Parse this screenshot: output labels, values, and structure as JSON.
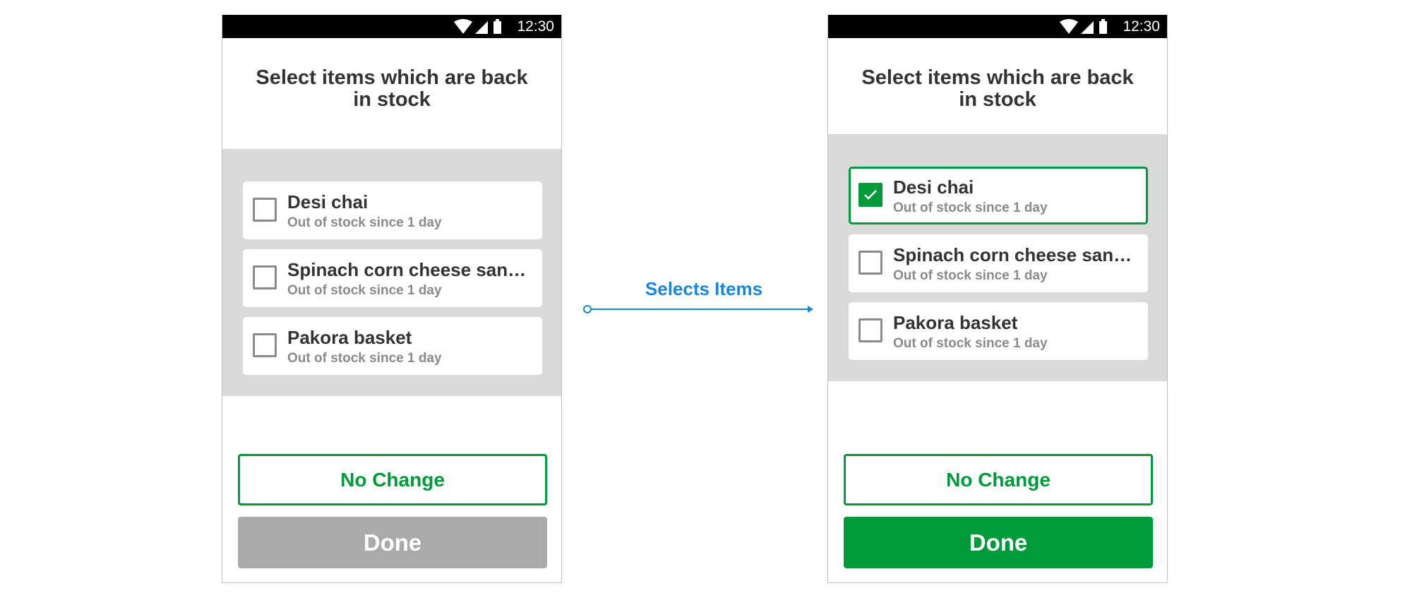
{
  "status_bar": {
    "time": "12:30"
  },
  "transition": {
    "label": "Selects Items"
  },
  "screens": [
    {
      "title": "Select items which are back in stock",
      "items": [
        {
          "name": "Desi chai",
          "status": "Out of stock since 1 day",
          "checked": false
        },
        {
          "name": "Spinach corn cheese sandwich",
          "status": "Out of stock since 1 day",
          "checked": false
        },
        {
          "name": "Pakora basket",
          "status": "Out of stock since 1 day",
          "checked": false
        }
      ],
      "no_change_label": "No Change",
      "done_label": "Done",
      "done_state": "disabled"
    },
    {
      "title": "Select items which are back in stock",
      "items": [
        {
          "name": "Desi chai",
          "status": "Out of stock since 1 day",
          "checked": true
        },
        {
          "name": "Spinach corn cheese sandwich",
          "status": "Out of stock since 1 day",
          "checked": false
        },
        {
          "name": "Pakora basket",
          "status": "Out of stock since 1 day",
          "checked": false
        }
      ],
      "no_change_label": "No Change",
      "done_label": "Done",
      "done_state": "enabled"
    }
  ],
  "colors": {
    "accent_green": "#009a3a",
    "disabled_gray": "#aaaaaa",
    "arrow_blue": "#1a87d6",
    "panel_gray": "#d9d9d9"
  },
  "icons": {
    "wifi": "wifi-icon",
    "signal": "signal-icon",
    "battery": "battery-icon",
    "check": "check-icon"
  }
}
